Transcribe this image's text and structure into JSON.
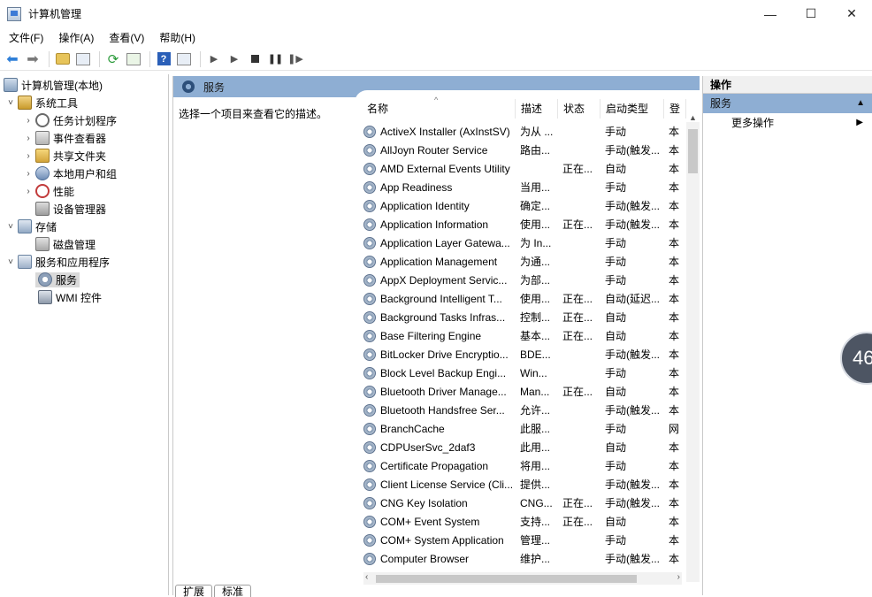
{
  "window": {
    "title": "计算机管理",
    "minimize": "—",
    "maximize": "☐",
    "close": "✕"
  },
  "menu": [
    "文件(F)",
    "操作(A)",
    "查看(V)",
    "帮助(H)"
  ],
  "toolbar": {
    "icons": [
      "back-arrow-icon",
      "forward-arrow-icon",
      "folder-up-icon",
      "show-hide-tree-icon",
      "refresh-icon",
      "export-icon",
      "help-icon",
      "console-tree-icon",
      "start-service-icon",
      "start-service-alt-icon",
      "stop-service-icon",
      "pause-service-icon",
      "restart-service-icon"
    ]
  },
  "tree": [
    {
      "label": "计算机管理(本地)",
      "level": 0,
      "icon": "computer-icon",
      "arrow": ""
    },
    {
      "label": "系统工具",
      "level": 1,
      "icon": "tools-icon",
      "arrow": "˅"
    },
    {
      "label": "任务计划程序",
      "level": 2,
      "icon": "clock-icon",
      "arrow": "›"
    },
    {
      "label": "事件查看器",
      "level": 2,
      "icon": "event-viewer-icon",
      "arrow": "›"
    },
    {
      "label": "共享文件夹",
      "level": 2,
      "icon": "shared-folder-icon",
      "arrow": "›"
    },
    {
      "label": "本地用户和组",
      "level": 2,
      "icon": "users-icon",
      "arrow": "›"
    },
    {
      "label": "性能",
      "level": 2,
      "icon": "performance-icon",
      "arrow": "›"
    },
    {
      "label": "设备管理器",
      "level": 2,
      "icon": "device-manager-icon",
      "arrow": ""
    },
    {
      "label": "存储",
      "level": 1,
      "icon": "storage-icon",
      "arrow": "˅"
    },
    {
      "label": "磁盘管理",
      "level": 2,
      "icon": "disk-icon",
      "arrow": ""
    },
    {
      "label": "服务和应用程序",
      "level": 1,
      "icon": "services-apps-icon",
      "arrow": "˅"
    },
    {
      "label": "服务",
      "level": 2,
      "icon": "gear-icon",
      "arrow": "",
      "selected": true
    },
    {
      "label": "WMI 控件",
      "level": 2,
      "icon": "wmi-icon",
      "arrow": ""
    }
  ],
  "middle": {
    "header": "服务",
    "description": "选择一个项目来查看它的描述。",
    "columns": [
      "名称",
      "描述",
      "状态",
      "启动类型",
      "登"
    ],
    "services": [
      {
        "name": "ActiveX Installer (AxInstSV)",
        "desc": "为从 ...",
        "status": "",
        "startup": "手动",
        "logon": "本"
      },
      {
        "name": "AllJoyn Router Service",
        "desc": "路由...",
        "status": "",
        "startup": "手动(触发...",
        "logon": "本"
      },
      {
        "name": "AMD External Events Utility",
        "desc": "",
        "status": "正在...",
        "startup": "自动",
        "logon": "本"
      },
      {
        "name": "App Readiness",
        "desc": "当用...",
        "status": "",
        "startup": "手动",
        "logon": "本"
      },
      {
        "name": "Application Identity",
        "desc": "确定...",
        "status": "",
        "startup": "手动(触发...",
        "logon": "本"
      },
      {
        "name": "Application Information",
        "desc": "使用...",
        "status": "正在...",
        "startup": "手动(触发...",
        "logon": "本"
      },
      {
        "name": "Application Layer Gatewa...",
        "desc": "为 In...",
        "status": "",
        "startup": "手动",
        "logon": "本"
      },
      {
        "name": "Application Management",
        "desc": "为通...",
        "status": "",
        "startup": "手动",
        "logon": "本"
      },
      {
        "name": "AppX Deployment Servic...",
        "desc": "为部...",
        "status": "",
        "startup": "手动",
        "logon": "本"
      },
      {
        "name": "Background Intelligent T...",
        "desc": "使用...",
        "status": "正在...",
        "startup": "自动(延迟...",
        "logon": "本"
      },
      {
        "name": "Background Tasks Infras...",
        "desc": "控制...",
        "status": "正在...",
        "startup": "自动",
        "logon": "本"
      },
      {
        "name": "Base Filtering Engine",
        "desc": "基本...",
        "status": "正在...",
        "startup": "自动",
        "logon": "本"
      },
      {
        "name": "BitLocker Drive Encryptio...",
        "desc": "BDE...",
        "status": "",
        "startup": "手动(触发...",
        "logon": "本"
      },
      {
        "name": "Block Level Backup Engi...",
        "desc": "Win...",
        "status": "",
        "startup": "手动",
        "logon": "本"
      },
      {
        "name": "Bluetooth Driver Manage...",
        "desc": "Man...",
        "status": "正在...",
        "startup": "自动",
        "logon": "本"
      },
      {
        "name": "Bluetooth Handsfree Ser...",
        "desc": "允许...",
        "status": "",
        "startup": "手动(触发...",
        "logon": "本"
      },
      {
        "name": "BranchCache",
        "desc": "此服...",
        "status": "",
        "startup": "手动",
        "logon": "网"
      },
      {
        "name": "CDPUserSvc_2daf3",
        "desc": "此用...",
        "status": "",
        "startup": "自动",
        "logon": "本"
      },
      {
        "name": "Certificate Propagation",
        "desc": "将用...",
        "status": "",
        "startup": "手动",
        "logon": "本"
      },
      {
        "name": "Client License Service (Cli...",
        "desc": "提供...",
        "status": "",
        "startup": "手动(触发...",
        "logon": "本"
      },
      {
        "name": "CNG Key Isolation",
        "desc": "CNG...",
        "status": "正在...",
        "startup": "手动(触发...",
        "logon": "本"
      },
      {
        "name": "COM+ Event System",
        "desc": "支持...",
        "status": "正在...",
        "startup": "自动",
        "logon": "本"
      },
      {
        "name": "COM+ System Application",
        "desc": "管理...",
        "status": "",
        "startup": "手动",
        "logon": "本"
      },
      {
        "name": "Computer Browser",
        "desc": "维护...",
        "status": "",
        "startup": "手动(触发...",
        "logon": "本"
      }
    ],
    "tabs": [
      "扩展",
      "标准"
    ]
  },
  "actions": {
    "title": "操作",
    "section": "服务",
    "items": [
      "更多操作"
    ]
  },
  "overlay": {
    "text": "46"
  },
  "colors": {
    "header_blue": "#8eaed3",
    "selection_gray": "#d9d9d9"
  }
}
